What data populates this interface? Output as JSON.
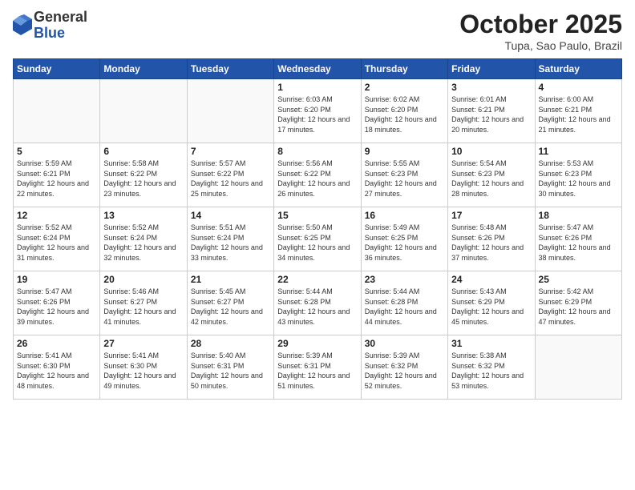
{
  "logo": {
    "general": "General",
    "blue": "Blue"
  },
  "header": {
    "month": "October 2025",
    "location": "Tupa, Sao Paulo, Brazil"
  },
  "weekdays": [
    "Sunday",
    "Monday",
    "Tuesday",
    "Wednesday",
    "Thursday",
    "Friday",
    "Saturday"
  ],
  "weeks": [
    [
      {
        "day": "",
        "sunrise": "",
        "sunset": "",
        "daylight": ""
      },
      {
        "day": "",
        "sunrise": "",
        "sunset": "",
        "daylight": ""
      },
      {
        "day": "",
        "sunrise": "",
        "sunset": "",
        "daylight": ""
      },
      {
        "day": "1",
        "sunrise": "Sunrise: 6:03 AM",
        "sunset": "Sunset: 6:20 PM",
        "daylight": "Daylight: 12 hours and 17 minutes."
      },
      {
        "day": "2",
        "sunrise": "Sunrise: 6:02 AM",
        "sunset": "Sunset: 6:20 PM",
        "daylight": "Daylight: 12 hours and 18 minutes."
      },
      {
        "day": "3",
        "sunrise": "Sunrise: 6:01 AM",
        "sunset": "Sunset: 6:21 PM",
        "daylight": "Daylight: 12 hours and 20 minutes."
      },
      {
        "day": "4",
        "sunrise": "Sunrise: 6:00 AM",
        "sunset": "Sunset: 6:21 PM",
        "daylight": "Daylight: 12 hours and 21 minutes."
      }
    ],
    [
      {
        "day": "5",
        "sunrise": "Sunrise: 5:59 AM",
        "sunset": "Sunset: 6:21 PM",
        "daylight": "Daylight: 12 hours and 22 minutes."
      },
      {
        "day": "6",
        "sunrise": "Sunrise: 5:58 AM",
        "sunset": "Sunset: 6:22 PM",
        "daylight": "Daylight: 12 hours and 23 minutes."
      },
      {
        "day": "7",
        "sunrise": "Sunrise: 5:57 AM",
        "sunset": "Sunset: 6:22 PM",
        "daylight": "Daylight: 12 hours and 25 minutes."
      },
      {
        "day": "8",
        "sunrise": "Sunrise: 5:56 AM",
        "sunset": "Sunset: 6:22 PM",
        "daylight": "Daylight: 12 hours and 26 minutes."
      },
      {
        "day": "9",
        "sunrise": "Sunrise: 5:55 AM",
        "sunset": "Sunset: 6:23 PM",
        "daylight": "Daylight: 12 hours and 27 minutes."
      },
      {
        "day": "10",
        "sunrise": "Sunrise: 5:54 AM",
        "sunset": "Sunset: 6:23 PM",
        "daylight": "Daylight: 12 hours and 28 minutes."
      },
      {
        "day": "11",
        "sunrise": "Sunrise: 5:53 AM",
        "sunset": "Sunset: 6:23 PM",
        "daylight": "Daylight: 12 hours and 30 minutes."
      }
    ],
    [
      {
        "day": "12",
        "sunrise": "Sunrise: 5:52 AM",
        "sunset": "Sunset: 6:24 PM",
        "daylight": "Daylight: 12 hours and 31 minutes."
      },
      {
        "day": "13",
        "sunrise": "Sunrise: 5:52 AM",
        "sunset": "Sunset: 6:24 PM",
        "daylight": "Daylight: 12 hours and 32 minutes."
      },
      {
        "day": "14",
        "sunrise": "Sunrise: 5:51 AM",
        "sunset": "Sunset: 6:24 PM",
        "daylight": "Daylight: 12 hours and 33 minutes."
      },
      {
        "day": "15",
        "sunrise": "Sunrise: 5:50 AM",
        "sunset": "Sunset: 6:25 PM",
        "daylight": "Daylight: 12 hours and 34 minutes."
      },
      {
        "day": "16",
        "sunrise": "Sunrise: 5:49 AM",
        "sunset": "Sunset: 6:25 PM",
        "daylight": "Daylight: 12 hours and 36 minutes."
      },
      {
        "day": "17",
        "sunrise": "Sunrise: 5:48 AM",
        "sunset": "Sunset: 6:26 PM",
        "daylight": "Daylight: 12 hours and 37 minutes."
      },
      {
        "day": "18",
        "sunrise": "Sunrise: 5:47 AM",
        "sunset": "Sunset: 6:26 PM",
        "daylight": "Daylight: 12 hours and 38 minutes."
      }
    ],
    [
      {
        "day": "19",
        "sunrise": "Sunrise: 5:47 AM",
        "sunset": "Sunset: 6:26 PM",
        "daylight": "Daylight: 12 hours and 39 minutes."
      },
      {
        "day": "20",
        "sunrise": "Sunrise: 5:46 AM",
        "sunset": "Sunset: 6:27 PM",
        "daylight": "Daylight: 12 hours and 41 minutes."
      },
      {
        "day": "21",
        "sunrise": "Sunrise: 5:45 AM",
        "sunset": "Sunset: 6:27 PM",
        "daylight": "Daylight: 12 hours and 42 minutes."
      },
      {
        "day": "22",
        "sunrise": "Sunrise: 5:44 AM",
        "sunset": "Sunset: 6:28 PM",
        "daylight": "Daylight: 12 hours and 43 minutes."
      },
      {
        "day": "23",
        "sunrise": "Sunrise: 5:44 AM",
        "sunset": "Sunset: 6:28 PM",
        "daylight": "Daylight: 12 hours and 44 minutes."
      },
      {
        "day": "24",
        "sunrise": "Sunrise: 5:43 AM",
        "sunset": "Sunset: 6:29 PM",
        "daylight": "Daylight: 12 hours and 45 minutes."
      },
      {
        "day": "25",
        "sunrise": "Sunrise: 5:42 AM",
        "sunset": "Sunset: 6:29 PM",
        "daylight": "Daylight: 12 hours and 47 minutes."
      }
    ],
    [
      {
        "day": "26",
        "sunrise": "Sunrise: 5:41 AM",
        "sunset": "Sunset: 6:30 PM",
        "daylight": "Daylight: 12 hours and 48 minutes."
      },
      {
        "day": "27",
        "sunrise": "Sunrise: 5:41 AM",
        "sunset": "Sunset: 6:30 PM",
        "daylight": "Daylight: 12 hours and 49 minutes."
      },
      {
        "day": "28",
        "sunrise": "Sunrise: 5:40 AM",
        "sunset": "Sunset: 6:31 PM",
        "daylight": "Daylight: 12 hours and 50 minutes."
      },
      {
        "day": "29",
        "sunrise": "Sunrise: 5:39 AM",
        "sunset": "Sunset: 6:31 PM",
        "daylight": "Daylight: 12 hours and 51 minutes."
      },
      {
        "day": "30",
        "sunrise": "Sunrise: 5:39 AM",
        "sunset": "Sunset: 6:32 PM",
        "daylight": "Daylight: 12 hours and 52 minutes."
      },
      {
        "day": "31",
        "sunrise": "Sunrise: 5:38 AM",
        "sunset": "Sunset: 6:32 PM",
        "daylight": "Daylight: 12 hours and 53 minutes."
      },
      {
        "day": "",
        "sunrise": "",
        "sunset": "",
        "daylight": ""
      }
    ]
  ]
}
